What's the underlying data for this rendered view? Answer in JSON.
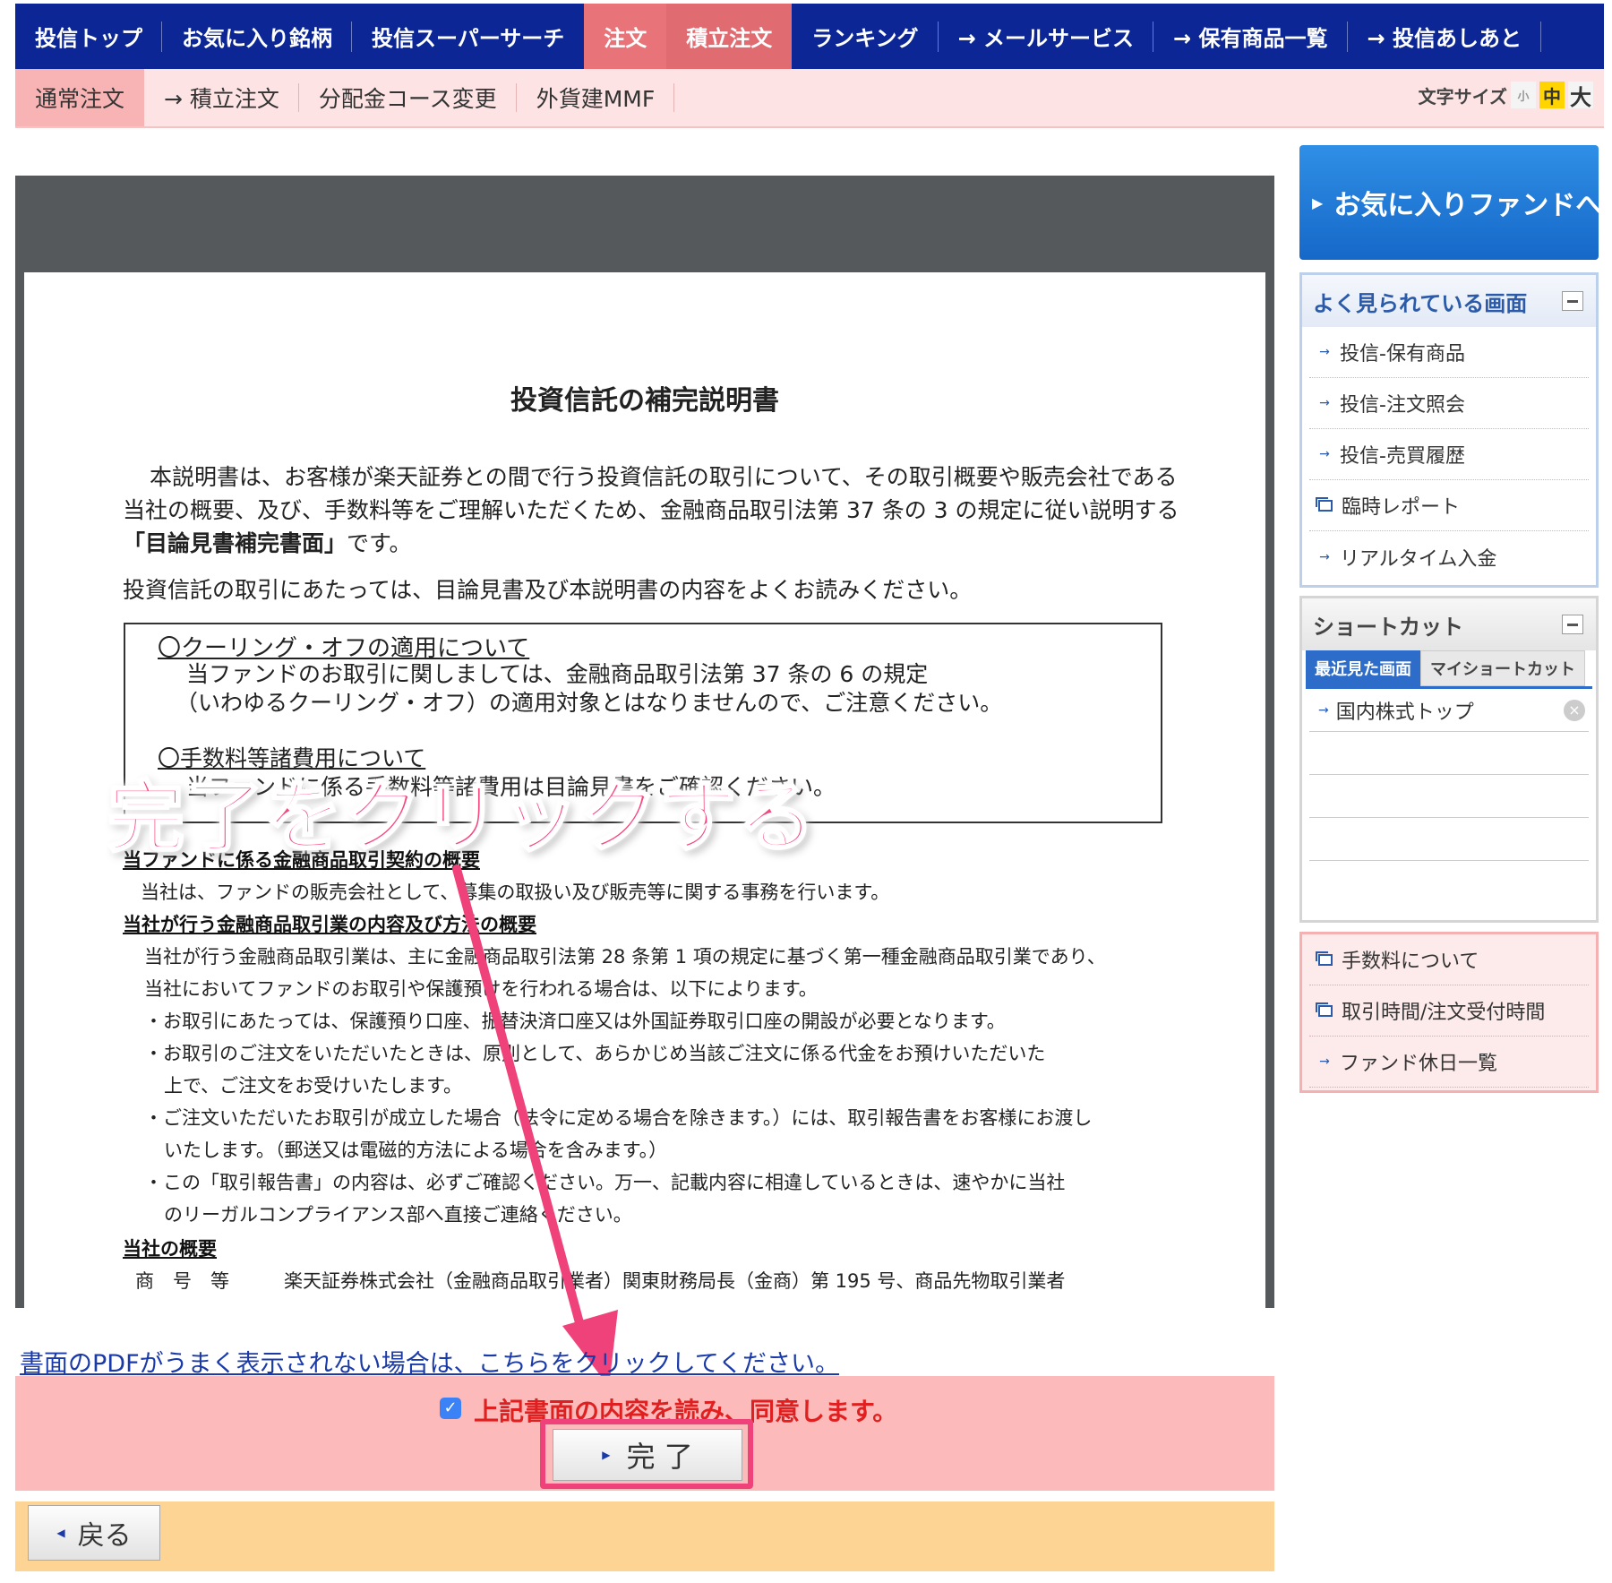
{
  "topnav": {
    "items": [
      "投信トップ",
      "お気に入り銘柄",
      "投信スーパーサーチ",
      "注文",
      "積立注文",
      "ランキング",
      "→ メールサービス",
      "→ 保有商品一覧",
      "→ 投信あしあと"
    ]
  },
  "subnav": {
    "items": [
      "通常注文",
      "→ 積立注文",
      "分配金コース変更",
      "外貨建MMF"
    ],
    "font_size_label": "文字サイズ",
    "font_sizes": [
      "小",
      "中",
      "大"
    ]
  },
  "document": {
    "title": "投資信託の補完説明書",
    "p1_a": "本説明書は、お客様が楽天証券との間で行う投資信託の取引について、その取引概要や販売会社である当社の概要、及び、手数料等をご理解いただくため、金融商品取引法第 37 条の 3 の規定に従い説明する",
    "p1_b": "「目論見書補完書面」",
    "p1_c": "です。",
    "p2": "投資信託の取引にあたっては、目論見書及び本説明書の内容をよくお読みください。",
    "box_heading": "〇クーリング・オフの適用について",
    "box_line1": "当ファンドのお取引に関しましては、金融商品取引法第 37 条の 6 の規定",
    "box_line2": "（いわゆるクーリング・オフ）の適用対象とはなりませんので、ご注意ください。",
    "box_line3": "〇手数料等諸費用について",
    "box_line4": "当ファンドに係る手数料等諸費用は目論見書をご確認ください。",
    "sec1_title": "当ファンドに係る金融商品取引契約の概要",
    "sec1_text": "当社は、ファンドの販売会社として、募集の取扱い及び販売等に関する事務を行います。",
    "sec2_title": "当社が行う金融商品取引業の内容及び方法の概要",
    "sec2_line1": "当社が行う金融商品取引業は、主に金融商品取引法第 28 条第 1 項の規定に基づく第一種金融商品取引業であり、",
    "sec2_line2": "当社においてファンドのお取引や保護預けを行われる場合は、以下によります。",
    "sec2_b1": "・お取引にあたっては、保護預り口座、振替決済口座又は外国証券取引口座の開設が必要となります。",
    "sec2_b2a": "・お取引のご注文をいただいたときは、原則として、あらかじめ当該ご注文に係る代金をお預けいただいた",
    "sec2_b2b": "上で、ご注文をお受けいたします。",
    "sec2_b3a": "・ご注文いただいたお取引が成立した場合（法令に定める場合を除きます。）には、取引報告書をお客様にお渡し",
    "sec2_b3b": "いたします。（郵送又は電磁的方法による場合を含みます。）",
    "sec2_b4a": "・この「取引報告書」の内容は、必ずご確認ください。万一、記載内容に相違しているときは、速やかに当社",
    "sec2_b4b": "のリーガルコンプライアンス部へ直接ご連絡ください。",
    "sec3_title": "当社の概要",
    "sec3_label": "商　号　等",
    "sec3_value": "楽天証券株式会社（金融商品取引業者）関東財務局長（金商）第 195 号、商品先物取引業者"
  },
  "annotation": "完了をクリックする",
  "pdf_link": "書面のPDFがうまく表示されない場合は、こちらをクリックしてください。",
  "agree": {
    "checked": true,
    "label": "上記書面の内容を読み、同意します。",
    "done_button": "完 了"
  },
  "back_button": "戻る",
  "sidebar": {
    "fav_button": "お気に入りファンドへ",
    "frequent": {
      "title": "よく見られている画面",
      "items": [
        "投信-保有商品",
        "投信-注文照会",
        "投信-売買履歴",
        "臨時レポート",
        "リアルタイム入金"
      ]
    },
    "shortcut": {
      "title": "ショートカット",
      "tab_recent": "最近見た画面",
      "tab_my": "マイショートカット",
      "items": [
        "国内株式トップ"
      ]
    },
    "info": {
      "items": [
        "手数料について",
        "取引時間/注文受付時間",
        "ファンド休日一覧"
      ]
    }
  },
  "colors": {
    "nav_bg": "#0c2795",
    "nav_active": "#e8747a",
    "annotation": "#f7487e",
    "agree_bg": "#fdbaba",
    "back_bg": "#fdd493"
  }
}
